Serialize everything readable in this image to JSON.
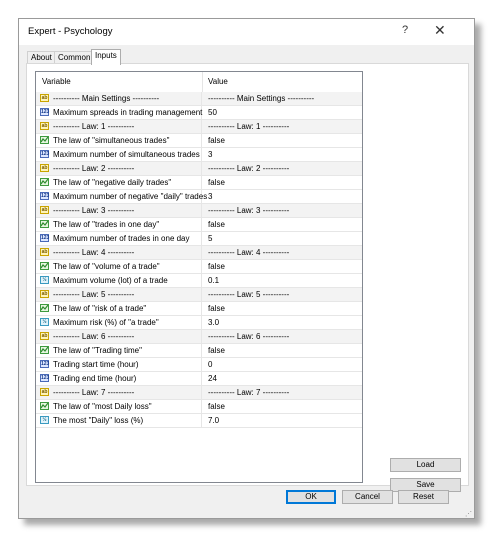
{
  "window": {
    "title": "Expert - Psychology",
    "help_glyph": "?",
    "close_glyph": "✕"
  },
  "tabs": [
    {
      "label": "About"
    },
    {
      "label": "Common"
    },
    {
      "label": "Inputs",
      "active": true
    }
  ],
  "grid": {
    "headers": {
      "variable": "Variable",
      "value": "Value"
    },
    "rows": [
      {
        "icon": "ab",
        "variable": "---------- Main Settings ----------",
        "value": "---------- Main Settings ----------",
        "sep": true
      },
      {
        "icon": "123",
        "variable": "Maximum spreads in trading management",
        "value": "50"
      },
      {
        "icon": "ab",
        "variable": "---------- Law: 1 ----------",
        "value": "---------- Law: 1 ----------",
        "sep": true
      },
      {
        "icon": "bool",
        "variable": "The law of \"simultaneous trades\"",
        "value": "false"
      },
      {
        "icon": "123",
        "variable": "Maximum number of simultaneous trades",
        "value": "3"
      },
      {
        "icon": "ab",
        "variable": "---------- Law: 2 ----------",
        "value": "---------- Law: 2 ----------",
        "sep": true
      },
      {
        "icon": "bool",
        "variable": "The law of \"negative daily trades\"",
        "value": "false"
      },
      {
        "icon": "123",
        "variable": "Maximum number of negative \"daily\" trades",
        "value": "3"
      },
      {
        "icon": "ab",
        "variable": "---------- Law: 3 ----------",
        "value": "---------- Law: 3 ----------",
        "sep": true
      },
      {
        "icon": "bool",
        "variable": "The law of \"trades in one day\"",
        "value": "false"
      },
      {
        "icon": "123",
        "variable": "Maximum number of trades in one day",
        "value": "5"
      },
      {
        "icon": "ab",
        "variable": "---------- Law: 4 ----------",
        "value": "---------- Law: 4 ----------",
        "sep": true
      },
      {
        "icon": "bool",
        "variable": "The law of \"volume of a trade\"",
        "value": "false"
      },
      {
        "icon": "12",
        "variable": "Maximum volume (lot) of a trade",
        "value": "0.1"
      },
      {
        "icon": "ab",
        "variable": "---------- Law: 5 ----------",
        "value": "---------- Law: 5 ----------",
        "sep": true
      },
      {
        "icon": "bool",
        "variable": "The law of \"risk of a trade\"",
        "value": "false"
      },
      {
        "icon": "12",
        "variable": "Maximum risk (%) of \"a trade\"",
        "value": "3.0"
      },
      {
        "icon": "ab",
        "variable": "---------- Law: 6 ----------",
        "value": "---------- Law: 6 ----------",
        "sep": true
      },
      {
        "icon": "bool",
        "variable": "The law of \"Trading time\"",
        "value": "false"
      },
      {
        "icon": "123",
        "variable": "Trading start time (hour)",
        "value": "0"
      },
      {
        "icon": "123",
        "variable": "Trading end time (hour)",
        "value": "24"
      },
      {
        "icon": "ab",
        "variable": "---------- Law: 7 ----------",
        "value": "---------- Law: 7 ----------",
        "sep": true
      },
      {
        "icon": "bool",
        "variable": "The law of \"most Daily loss\"",
        "value": "false"
      },
      {
        "icon": "12",
        "variable": "The most \"Daily\" loss (%)",
        "value": "7.0"
      }
    ]
  },
  "side_buttons": {
    "load": "Load",
    "save": "Save"
  },
  "footer_buttons": {
    "ok": "OK",
    "cancel": "Cancel",
    "reset": "Reset"
  },
  "icon_text": {
    "ab": "ab",
    "123": "123",
    "12": "½",
    "bool": ""
  },
  "icon_names": {
    "ab": "string-type-icon",
    "123": "integer-type-icon",
    "12": "double-type-icon",
    "bool": "boolean-type-icon"
  }
}
